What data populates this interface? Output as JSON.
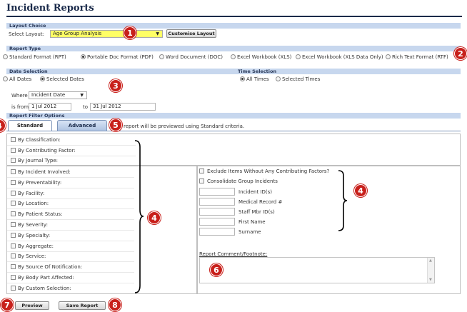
{
  "page_title": "Incident Reports",
  "layout_choice": {
    "header": "Layout Choice",
    "select_label": "Select Layout:",
    "selected_layout": "Age Group Analysis",
    "customise_button": "Customise Layout"
  },
  "report_type": {
    "header": "Report Type",
    "options": [
      {
        "label": "Standard Format (RPT)",
        "selected": false
      },
      {
        "label": "Portable Doc Format (PDF)",
        "selected": true
      },
      {
        "label": "Word Document (DOC)",
        "selected": false
      },
      {
        "label": "Excel Workbook (XLS)",
        "selected": false
      },
      {
        "label": "Excel Workbook (XLS Data Only)",
        "selected": false
      },
      {
        "label": "Rich Text Format (RTF)",
        "selected": false
      }
    ]
  },
  "date_selection": {
    "header": "Date Selection",
    "options": [
      {
        "label": "All Dates",
        "selected": false
      },
      {
        "label": "Selected Dates",
        "selected": true
      }
    ],
    "where_label": "Where",
    "where_value": "Incident Date",
    "is_from_label": "is from",
    "from_value": "1 Jul 2012",
    "to_label": "to",
    "to_value": "31 Jul 2012"
  },
  "time_selection": {
    "header": "Time Selection",
    "options": [
      {
        "label": "All Times",
        "selected": true
      },
      {
        "label": "Selected Times",
        "selected": false
      }
    ]
  },
  "filter_options": {
    "header": "Report Filter Options",
    "tabs": [
      {
        "label": "Standard",
        "active": true
      },
      {
        "label": "Advanced",
        "active": false
      }
    ],
    "preview_note": "report will be previewed using Standard criteria.",
    "top_filters": [
      "By Classification:",
      "By Contributing Factor:",
      "By Journal Type:"
    ],
    "left_filters": [
      "By Incident Involved:",
      "By Preventability:",
      "By Facility:",
      "By Location:",
      "By Patient Status:",
      "By Severity:",
      "By Specialty:",
      "By Aggregate:",
      "By Service:",
      "By Source Of Notification:",
      "By Body Part Affected:",
      "By Custom Selection:"
    ],
    "right_checks": [
      "Exclude Items Without Any Contributing Factors?",
      "Consolidate Group Incidents"
    ],
    "right_fields": [
      "Incident ID(s)",
      "Medical Record #",
      "Staff Mbr ID(s)",
      "First Name",
      "Surname"
    ],
    "comment_label": "Report Comment/Footnote:"
  },
  "buttons": {
    "preview": "Preview",
    "save_report": "Save Report"
  },
  "badges": [
    "1",
    "2",
    "3",
    "4",
    "4",
    "4",
    "5",
    "6",
    "7",
    "8"
  ],
  "colors": {
    "badge": "#c8201b",
    "section_header": "#c7d7ee",
    "layout_highlight": "#ffff66",
    "title": "#1a2a4a"
  }
}
